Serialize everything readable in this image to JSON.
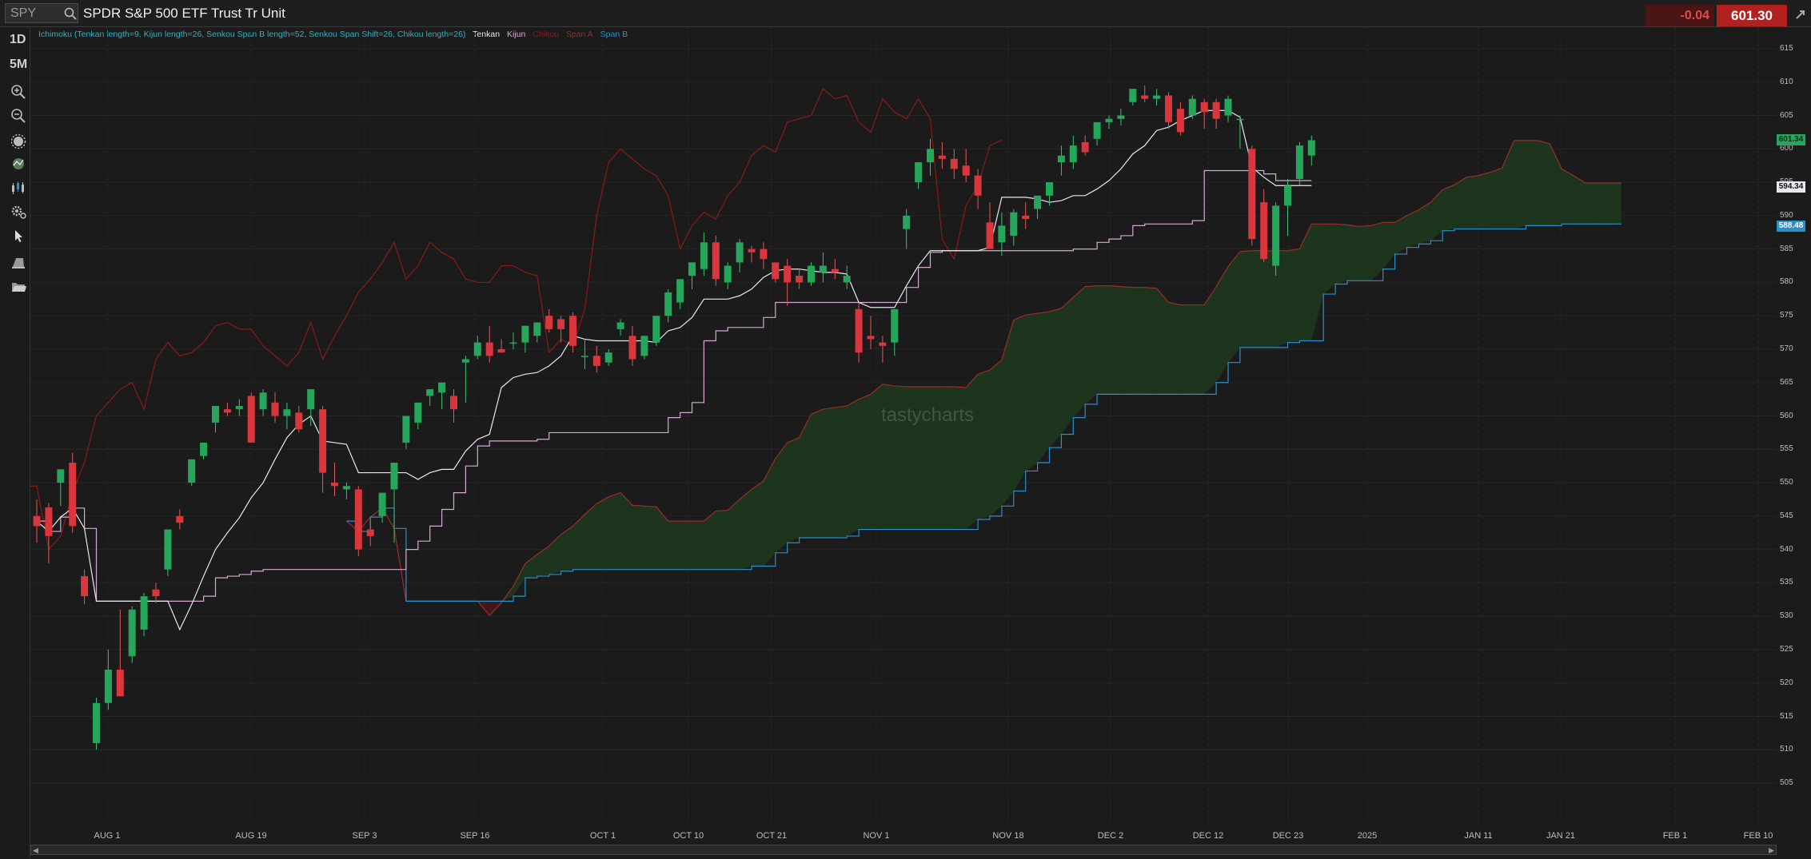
{
  "topbar": {
    "symbol_placeholder": "SPY",
    "symbol_name": "SPDR S&P 500 ETF Trust Tr Unit",
    "change": "-0.04",
    "last_price": "601.30"
  },
  "toolbar": {
    "timeframe": "1D",
    "interval": "5M",
    "icons": [
      "zoom-in-icon",
      "zoom-out-icon",
      "ichimoku-icon",
      "studies-icon",
      "chart-type-icon",
      "settings-icon",
      "cursor-icon",
      "drawing-icon",
      "folder-icon"
    ]
  },
  "legend": {
    "ichimoku": "Ichimoku (Tenkan length=9, Kijun length=26, Senkou Span B length=52, Senkou Span Shift=26, Chikou length=26)",
    "tenkan": "Tenkan",
    "kijun": "Kijun",
    "chikou": "Chikou",
    "span_a": "Span A",
    "span_b": "Span B"
  },
  "watermark": "tastycharts",
  "colors": {
    "up": "#26a65b",
    "down": "#d9363e",
    "tenkan": "#e8e8f0",
    "kijun": "#d7a8d6",
    "chikou": "#8a1a1a",
    "span_a": "#a02a2a",
    "span_b": "#2a8fc9",
    "cloud_bull": "#1c3a1c",
    "cloud_bear": "#4a1818"
  },
  "axis": {
    "price_ticks": [
      "615",
      "610",
      "605",
      "600",
      "595",
      "590",
      "585",
      "580",
      "575",
      "570",
      "565",
      "560",
      "555",
      "550",
      "545",
      "540",
      "535",
      "530",
      "525",
      "520",
      "515",
      "510",
      "505"
    ],
    "time_ticks": [
      "AUG 1",
      "AUG 19",
      "SEP 3",
      "SEP 16",
      "OCT 1",
      "OCT 10",
      "OCT 21",
      "NOV 1",
      "NOV 18",
      "DEC 2",
      "DEC 12",
      "DEC 23",
      "2025",
      "JAN 11",
      "JAN 21",
      "FEB 1",
      "FEB 10"
    ],
    "price_badges": {
      "last": "601.34",
      "tenkan": "594.34",
      "span_b": "588.48"
    }
  },
  "chart_data": {
    "type": "candlestick",
    "ylim": [
      504,
      616
    ],
    "candles_ohlc": [
      [
        545.0,
        547.5,
        541.0,
        543.5
      ],
      [
        546.3,
        547.0,
        537.9,
        542.0
      ],
      [
        550.0,
        551.8,
        546.5,
        552.0
      ],
      [
        553.0,
        554.5,
        542.5,
        543.5
      ],
      [
        536.0,
        537.0,
        531.8,
        533.0
      ],
      [
        511.0,
        517.8,
        510.0,
        517.0
      ],
      [
        517.0,
        525.0,
        516.0,
        522.0
      ],
      [
        522.0,
        531.0,
        518.5,
        518.0
      ],
      [
        524.0,
        531.5,
        523.0,
        531.0
      ],
      [
        528.0,
        533.5,
        527.0,
        533.0
      ],
      [
        534.0,
        535.0,
        532.0,
        533.0
      ],
      [
        537.0,
        543.0,
        536.0,
        543.0
      ],
      [
        545.0,
        546.0,
        543.0,
        544.0
      ],
      [
        550.0,
        553.5,
        549.5,
        553.5
      ],
      [
        554.0,
        556.0,
        553.5,
        556.0
      ],
      [
        559.0,
        561.5,
        557.5,
        561.5
      ],
      [
        561.0,
        562.0,
        560.0,
        560.5
      ],
      [
        561.0,
        562.5,
        560.0,
        561.5
      ],
      [
        563.0,
        563.5,
        556.0,
        556.0
      ],
      [
        561.0,
        564.0,
        560.0,
        563.5
      ],
      [
        562.0,
        563.5,
        559.0,
        560.0
      ],
      [
        560.0,
        562.0,
        558.0,
        561.0
      ],
      [
        560.5,
        561.5,
        557.5,
        558.0
      ],
      [
        561.0,
        564.0,
        558.5,
        564.0
      ],
      [
        561.0,
        561.5,
        548.5,
        551.5
      ],
      [
        550.0,
        553.0,
        548.0,
        549.5
      ],
      [
        549.0,
        550.0,
        547.5,
        549.5
      ],
      [
        549.0,
        549.5,
        539.0,
        540.0
      ],
      [
        543.0,
        544.5,
        540.5,
        542.0
      ],
      [
        545.0,
        548.0,
        544.0,
        548.5
      ],
      [
        549.0,
        550.0,
        541.0,
        553.0
      ],
      [
        556.0,
        560.0,
        555.0,
        560.0
      ],
      [
        559.0,
        562.0,
        558.0,
        562.0
      ],
      [
        563.0,
        564.0,
        561.5,
        564.0
      ],
      [
        563.5,
        565.0,
        561.0,
        565.0
      ],
      [
        563.0,
        564.0,
        559.0,
        561.0
      ],
      [
        568.0,
        569.0,
        562.0,
        568.5
      ],
      [
        569.0,
        572.0,
        568.5,
        571.0
      ],
      [
        571.0,
        573.5,
        568.0,
        569.0
      ],
      [
        570.0,
        571.5,
        569.5,
        569.5
      ],
      [
        571.0,
        572.5,
        570.0,
        571.0
      ],
      [
        571.0,
        573.5,
        569.5,
        573.5
      ],
      [
        572.0,
        574.0,
        571.0,
        574.0
      ],
      [
        575.0,
        576.0,
        572.5,
        573.0
      ],
      [
        574.5,
        575.0,
        571.0,
        573.0
      ],
      [
        575.0,
        575.5,
        569.5,
        570.5
      ],
      [
        569.0,
        571.5,
        567.0,
        569.0
      ],
      [
        569.0,
        570.5,
        566.5,
        567.5
      ],
      [
        568.0,
        570.0,
        567.5,
        569.5
      ],
      [
        573.0,
        574.5,
        572.0,
        574.0
      ],
      [
        572.0,
        573.5,
        567.5,
        568.5
      ],
      [
        569.0,
        572.0,
        568.5,
        572.0
      ],
      [
        571.0,
        575.0,
        570.5,
        575.0
      ],
      [
        575.0,
        579.0,
        574.0,
        578.5
      ],
      [
        577.0,
        580.0,
        576.0,
        580.5
      ],
      [
        581.0,
        583.0,
        579.0,
        583.0
      ],
      [
        582.0,
        587.5,
        581.0,
        586.0
      ],
      [
        586.0,
        587.0,
        579.5,
        580.5
      ],
      [
        580.0,
        583.0,
        579.0,
        582.5
      ],
      [
        583.0,
        586.5,
        581.5,
        586.0
      ],
      [
        585.0,
        585.5,
        583.0,
        584.5
      ],
      [
        585.0,
        586.0,
        582.0,
        583.5
      ],
      [
        583.0,
        583.0,
        580.0,
        580.5
      ],
      [
        582.5,
        583.5,
        576.5,
        580.0
      ],
      [
        581.0,
        582.0,
        579.0,
        580.0
      ],
      [
        580.0,
        583.0,
        579.5,
        582.5
      ],
      [
        581.5,
        584.5,
        580.0,
        582.5
      ],
      [
        582.0,
        583.5,
        580.5,
        581.5
      ],
      [
        580.0,
        582.5,
        579.0,
        581.0
      ],
      [
        576.0,
        577.0,
        568.0,
        569.5
      ],
      [
        572.0,
        575.0,
        570.0,
        571.5
      ],
      [
        571.0,
        572.0,
        568.0,
        570.5
      ],
      [
        571.0,
        573.0,
        569.0,
        576.0
      ],
      [
        588.0,
        591.0,
        585.0,
        590.0
      ],
      [
        595.0,
        597.0,
        594.0,
        598.0
      ],
      [
        598.0,
        601.5,
        596.0,
        600.0
      ],
      [
        599.0,
        601.0,
        597.0,
        598.5
      ],
      [
        598.5,
        600.0,
        595.5,
        597.0
      ],
      [
        597.5,
        600.0,
        595.0,
        596.0
      ],
      [
        596.0,
        597.0,
        591.0,
        593.0
      ],
      [
        589.0,
        592.0,
        587.0,
        585.0
      ],
      [
        586.0,
        590.5,
        584.0,
        588.5
      ],
      [
        587.0,
        591.0,
        585.5,
        590.5
      ],
      [
        590.0,
        592.0,
        588.0,
        589.5
      ],
      [
        591.0,
        593.0,
        589.5,
        593.0
      ],
      [
        593.0,
        595.0,
        591.5,
        595.0
      ],
      [
        598.0,
        600.5,
        596.0,
        599.0
      ],
      [
        598.0,
        602.0,
        597.0,
        600.5
      ],
      [
        601.0,
        602.0,
        599.0,
        599.5
      ],
      [
        601.5,
        604.0,
        600.5,
        604.0
      ],
      [
        604.0,
        605.0,
        603.0,
        604.5
      ],
      [
        604.5,
        606.0,
        603.5,
        605.0
      ],
      [
        607.0,
        609.0,
        606.5,
        609.0
      ],
      [
        608.0,
        609.5,
        607.0,
        607.5
      ],
      [
        607.5,
        609.0,
        606.5,
        608.0
      ],
      [
        608.0,
        608.5,
        603.0,
        604.0
      ],
      [
        606.0,
        607.0,
        602.0,
        602.5
      ],
      [
        605.0,
        608.0,
        604.5,
        607.5
      ],
      [
        607.0,
        607.5,
        603.0,
        605.5
      ],
      [
        607.0,
        607.5,
        603.0,
        604.5
      ],
      [
        605.0,
        608.0,
        604.0,
        607.5
      ],
      [
        604.5,
        605.0,
        600.0,
        604.5
      ],
      [
        600.0,
        600.5,
        585.5,
        586.5
      ],
      [
        592.0,
        594.0,
        583.0,
        583.5
      ],
      [
        582.5,
        592.0,
        581.0,
        591.5
      ],
      [
        591.5,
        595.5,
        587.0,
        594.5
      ],
      [
        595.5,
        601.0,
        594.5,
        600.5
      ],
      [
        599.0,
        602.0,
        597.5,
        601.3
      ]
    ],
    "ichimoku": {
      "tenkan_last": 594.34,
      "span_b_last": 588.48
    }
  }
}
